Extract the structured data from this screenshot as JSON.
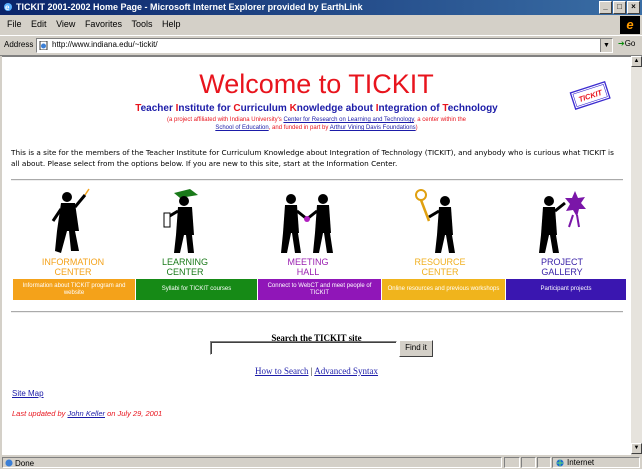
{
  "window": {
    "title": "TICKIT 2001-2002 Home Page - Microsoft Internet Explorer provided by EarthLink",
    "min": "_",
    "max": "□",
    "close": "×"
  },
  "menu": [
    "File",
    "Edit",
    "View",
    "Favorites",
    "Tools",
    "Help"
  ],
  "address": {
    "label": "Address",
    "url": "http://www.indiana.edu/~tickit/",
    "go": "Go"
  },
  "page": {
    "heading": "Welcome to TICKIT",
    "subtitle_parts": [
      {
        "t": "T",
        "red": true
      },
      {
        "t": "eacher ",
        "red": false
      },
      {
        "t": "I",
        "red": true
      },
      {
        "t": "nstitute for ",
        "red": false
      },
      {
        "t": "C",
        "red": true
      },
      {
        "t": "urriculum ",
        "red": false
      },
      {
        "t": "K",
        "red": true
      },
      {
        "t": "nowledge about ",
        "red": false
      },
      {
        "t": "I",
        "red": true
      },
      {
        "t": "ntegration of ",
        "red": false
      },
      {
        "t": "T",
        "red": true
      },
      {
        "t": "echnology",
        "red": false
      }
    ],
    "affil_1": "(a project affiliated with Indiana University's ",
    "affil_link1": "Center for Research on Learning and Technology",
    "affil_2": ", a center within the",
    "affil_link2": "School of Education",
    "affil_3": ", and funded in part by ",
    "affil_link3": "Arthur Vining Davis Foundations",
    "affil_4": ")",
    "ticket_text": "TICKIT",
    "intro": "This is a site for the members of the Teacher Institute for Curriculum Knowledge about Integration of Technology (TICKIT), and anybody who is curious what TICKIT is all about. Please select from the options below.  If you are new to this site, start at the Information Center.",
    "centers": [
      {
        "line1": "INFORMATION",
        "line2": "CENTER",
        "band": "Information about TICKIT program and website",
        "color": "#f4a21a",
        "band_color": "#f4a21a"
      },
      {
        "line1": "LEARNING",
        "line2": "CENTER",
        "band": "Syllabi for TICKIT courses",
        "color": "#1a7a1a",
        "band_color": "#168a16"
      },
      {
        "line1": "MEETING",
        "line2": "HALL",
        "band": "Connect to WebCT and meet people of TICKIT",
        "color": "#9a1fb0",
        "band_color": "#9016b8"
      },
      {
        "line1": "RESOURCE",
        "line2": "CENTER",
        "band": "Online resources and previous workshops",
        "color": "#f0b020",
        "band_color": "#f0b41c"
      },
      {
        "line1": "PROJECT",
        "line2": "GALLERY",
        "band": "Participant projects",
        "color": "#3a22a8",
        "band_color": "#3a16b0"
      }
    ],
    "search_label": "Search the TICKIT site",
    "search_value": "",
    "find_button": "Find it",
    "how_to_search": "How to Search",
    "sep": " | ",
    "advanced_syntax": "Advanced Syntax",
    "site_map": "Site Map",
    "updated_pre": "Last updated by ",
    "updated_author": "John Keller",
    "updated_post": " on July 29, 2001"
  },
  "status": {
    "text": "Done",
    "zone": "Internet"
  }
}
